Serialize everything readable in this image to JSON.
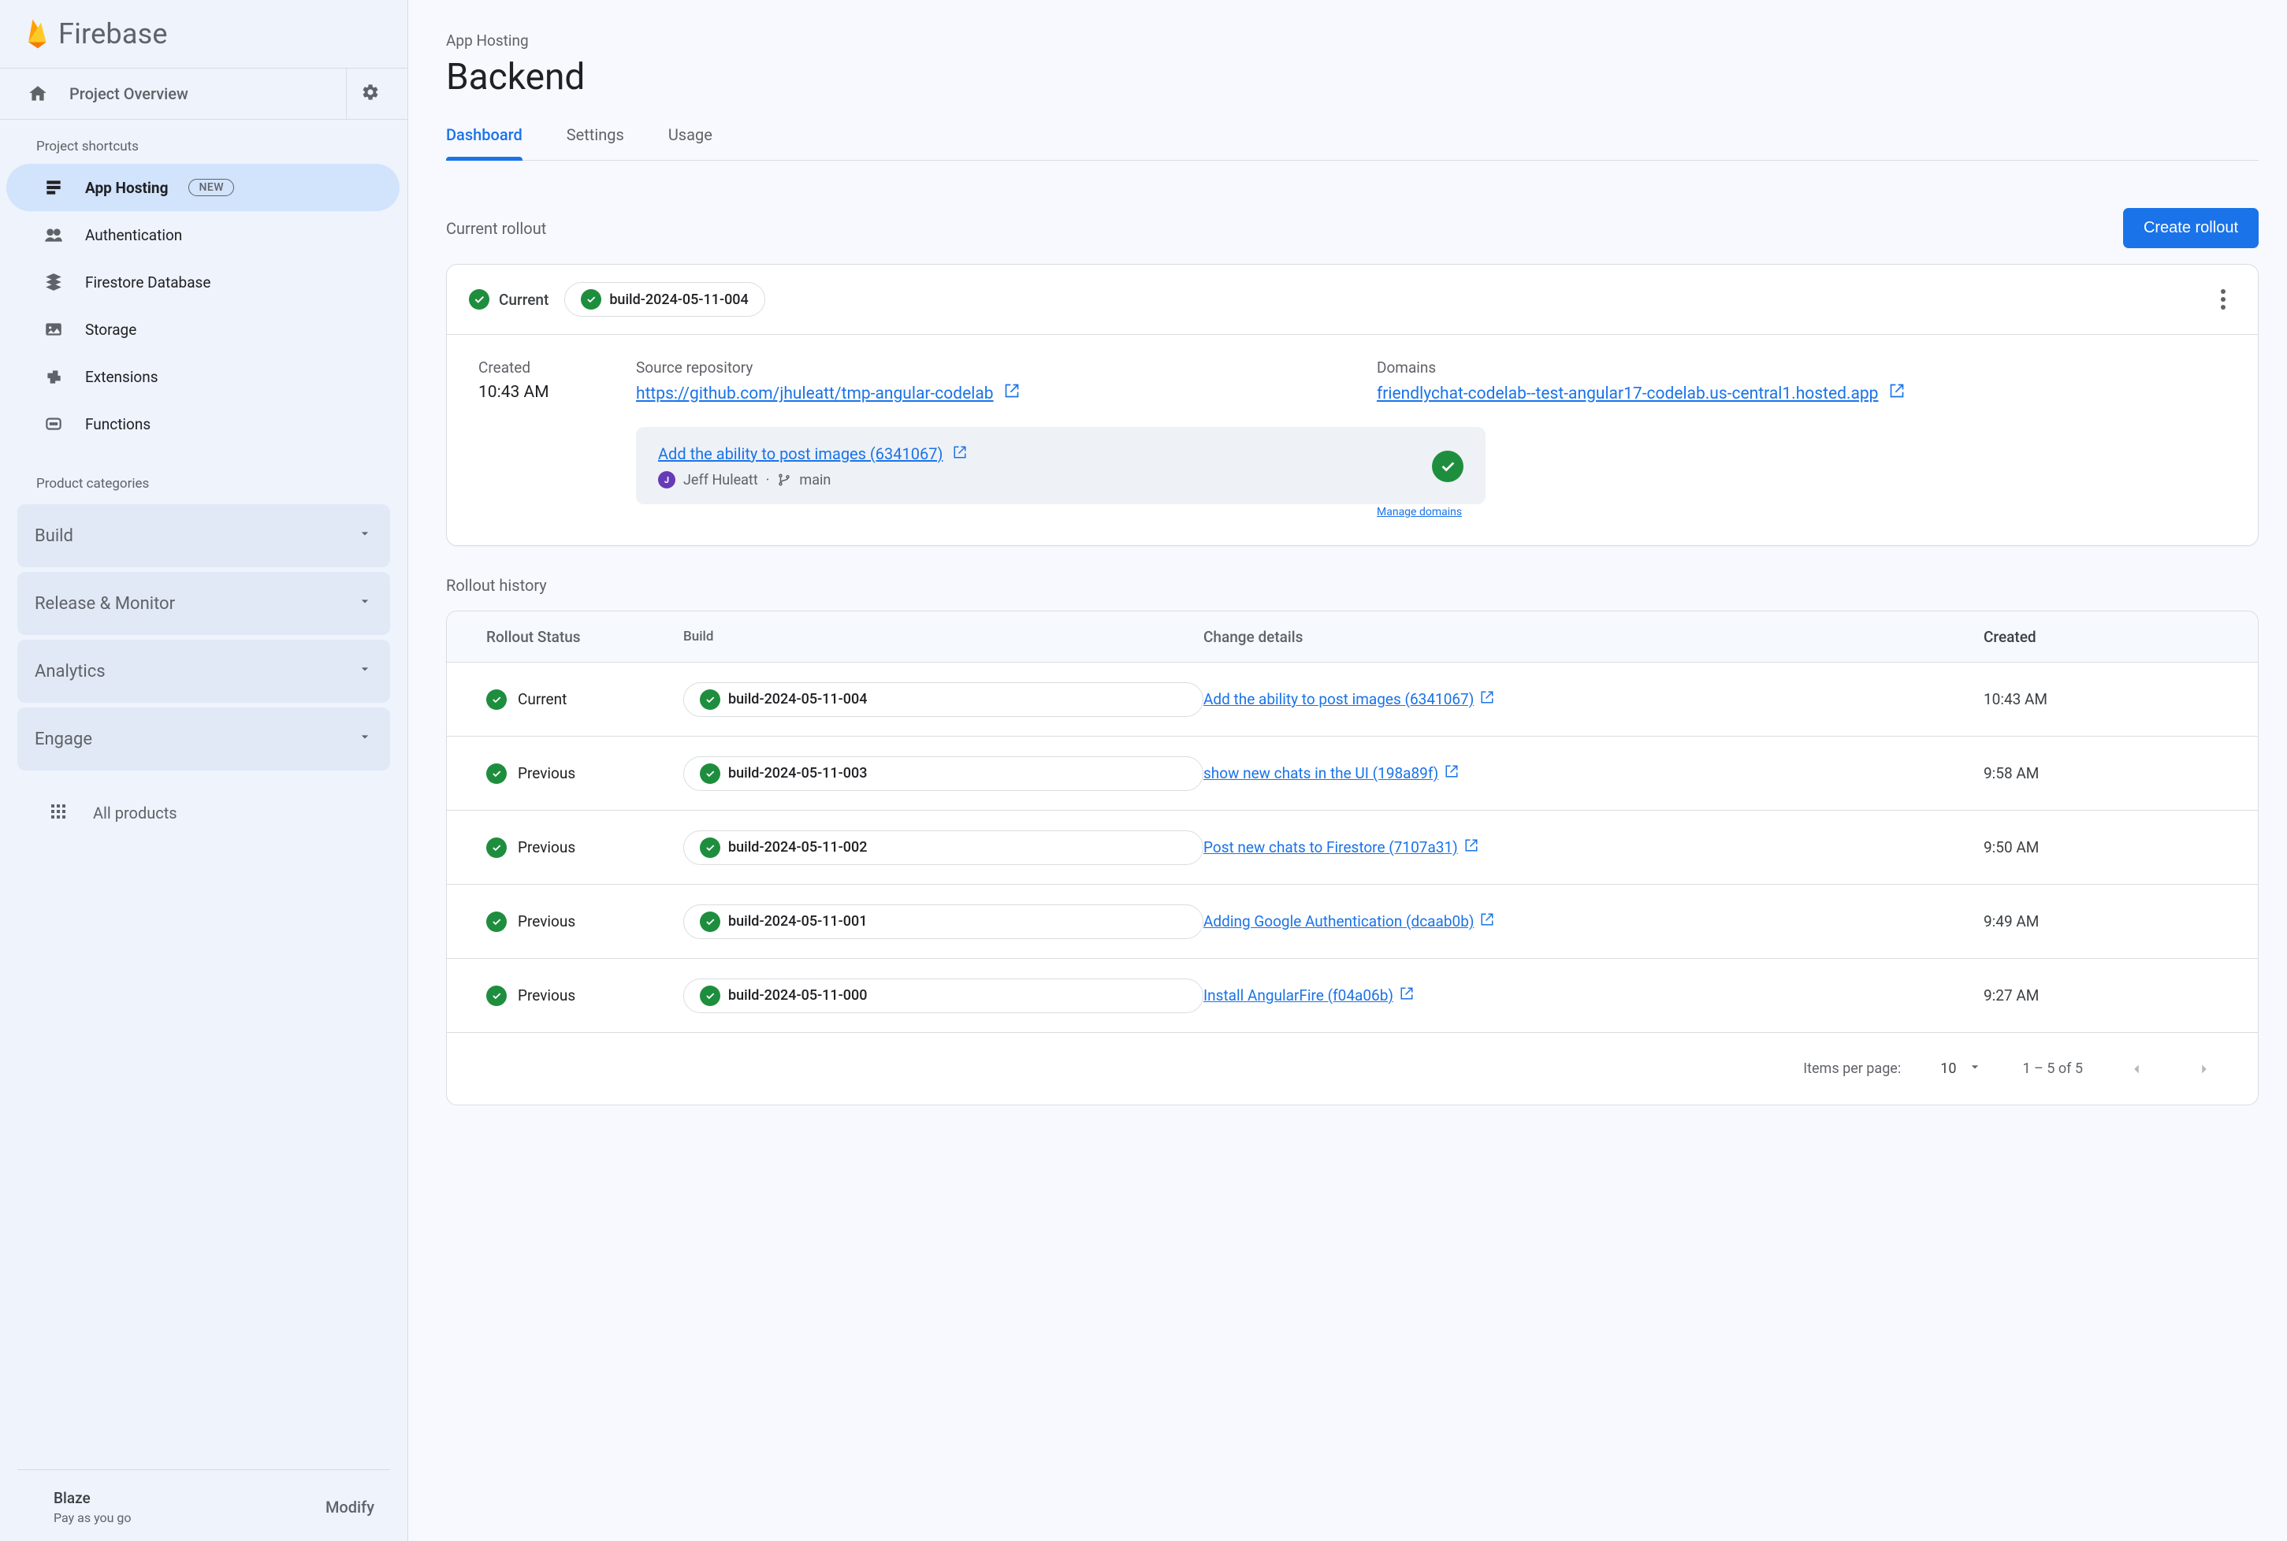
{
  "brand": {
    "name": "Firebase"
  },
  "sidebar": {
    "overview_label": "Project Overview",
    "shortcuts_label": "Project shortcuts",
    "categories_label": "Product categories",
    "items": [
      {
        "label": "App Hosting",
        "badge": "NEW",
        "icon": "apphosting-icon",
        "selected": true
      },
      {
        "label": "Authentication",
        "icon": "auth-icon"
      },
      {
        "label": "Firestore Database",
        "icon": "firestore-icon"
      },
      {
        "label": "Storage",
        "icon": "storage-icon"
      },
      {
        "label": "Extensions",
        "icon": "extensions-icon"
      },
      {
        "label": "Functions",
        "icon": "functions-icon"
      }
    ],
    "categories": [
      {
        "label": "Build"
      },
      {
        "label": "Release & Monitor"
      },
      {
        "label": "Analytics"
      },
      {
        "label": "Engage"
      }
    ],
    "all_products_label": "All products",
    "plan": {
      "name": "Blaze",
      "subtitle": "Pay as you go",
      "modify_label": "Modify"
    }
  },
  "header": {
    "breadcrumb": "App Hosting",
    "title": "Backend",
    "tabs": [
      {
        "label": "Dashboard",
        "active": true
      },
      {
        "label": "Settings"
      },
      {
        "label": "Usage"
      }
    ]
  },
  "current_rollout": {
    "section_label": "Current rollout",
    "cta": "Create rollout",
    "status_label": "Current",
    "build_id": "build-2024-05-11-004",
    "created_label": "Created",
    "created_value": "10:43 AM",
    "source_repo_label": "Source repository",
    "source_repo_url": "https://github.com/jhuleatt/tmp-angular-codelab",
    "domains_label": "Domains",
    "domain_url": "friendlychat-codelab--test-angular17-codelab.us-central1.hosted.app",
    "manage_domains_label": "Manage domains",
    "commit": {
      "title": "Add the ability to post images (6341067)",
      "author": "Jeff Huleatt",
      "branch": "main"
    }
  },
  "rollout_history": {
    "section_label": "Rollout history",
    "headers": {
      "status": "Rollout Status",
      "build": "Build",
      "change": "Change details",
      "created": "Created"
    },
    "rows": [
      {
        "status": "Current",
        "build": "build-2024-05-11-004",
        "change": "Add the ability to post images (6341067)",
        "created": "10:43 AM"
      },
      {
        "status": "Previous",
        "build": "build-2024-05-11-003",
        "change": "show new chats in the UI (198a89f)",
        "created": "9:58 AM"
      },
      {
        "status": "Previous",
        "build": "build-2024-05-11-002",
        "change": "Post new chats to Firestore (7107a31)",
        "created": "9:50 AM"
      },
      {
        "status": "Previous",
        "build": "build-2024-05-11-001",
        "change": "Adding Google Authentication (dcaab0b)",
        "created": "9:49 AM"
      },
      {
        "status": "Previous",
        "build": "build-2024-05-11-000",
        "change": "Install AngularFire (f04a06b)",
        "created": "9:27 AM"
      }
    ],
    "pagination": {
      "items_per_page_label": "Items per page:",
      "items_per_page_value": "10",
      "range_label": "1 – 5 of 5"
    }
  }
}
